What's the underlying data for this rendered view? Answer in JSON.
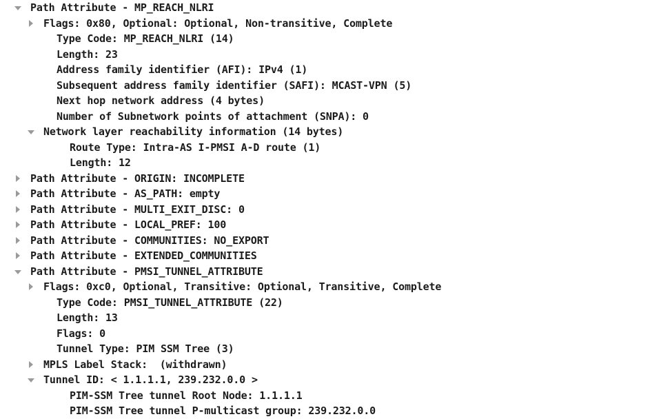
{
  "view": {
    "name": "packet-detail-tree",
    "app": "Wireshark packet details pane",
    "background_color": "#ffffff",
    "text_color": "#1b1b1b",
    "twisty_color": "#9a9a9a"
  },
  "tree": {
    "rows": [
      {
        "indent": 0,
        "twisty": "open",
        "twisty_icon": "triangle-down-icon",
        "name": "path-attribute-mp-reach-nlri",
        "label": "Path Attribute - MP_REACH_NLRI"
      },
      {
        "indent": 1,
        "twisty": "closed",
        "twisty_icon": "triangle-right-icon",
        "name": "mp-reach-flags",
        "label": "Flags: 0x80, Optional: Optional, Non-transitive, Complete"
      },
      {
        "indent": 2,
        "twisty": "none",
        "twisty_icon": "",
        "name": "mp-reach-type-code",
        "label": "Type Code: MP_REACH_NLRI (14)"
      },
      {
        "indent": 2,
        "twisty": "none",
        "twisty_icon": "",
        "name": "mp-reach-length",
        "label": "Length: 23"
      },
      {
        "indent": 2,
        "twisty": "none",
        "twisty_icon": "",
        "name": "address-family-identifier",
        "label": "Address family identifier (AFI): IPv4 (1)"
      },
      {
        "indent": 2,
        "twisty": "none",
        "twisty_icon": "",
        "name": "subsequent-address-family-identifier",
        "label": "Subsequent address family identifier (SAFI): MCAST-VPN (5)"
      },
      {
        "indent": 2,
        "twisty": "none",
        "twisty_icon": "",
        "name": "next-hop-network-address",
        "label": "Next hop network address (4 bytes)"
      },
      {
        "indent": 2,
        "twisty": "none",
        "twisty_icon": "",
        "name": "number-of-snpa",
        "label": "Number of Subnetwork points of attachment (SNPA): 0"
      },
      {
        "indent": 1,
        "twisty": "open",
        "twisty_icon": "triangle-down-icon",
        "name": "network-layer-reachability-information",
        "label": "Network layer reachability information (14 bytes)"
      },
      {
        "indent": 3,
        "twisty": "none",
        "twisty_icon": "",
        "name": "route-type",
        "label": "Route Type: Intra-AS I-PMSI A-D route (1)"
      },
      {
        "indent": 3,
        "twisty": "none",
        "twisty_icon": "",
        "name": "nlri-length",
        "label": "Length: 12"
      },
      {
        "indent": 0,
        "twisty": "closed",
        "twisty_icon": "triangle-right-icon",
        "name": "path-attribute-origin",
        "label": "Path Attribute - ORIGIN: INCOMPLETE"
      },
      {
        "indent": 0,
        "twisty": "closed",
        "twisty_icon": "triangle-right-icon",
        "name": "path-attribute-as-path",
        "label": "Path Attribute - AS_PATH: empty"
      },
      {
        "indent": 0,
        "twisty": "closed",
        "twisty_icon": "triangle-right-icon",
        "name": "path-attribute-multi-exit-disc",
        "label": "Path Attribute - MULTI_EXIT_DISC: 0"
      },
      {
        "indent": 0,
        "twisty": "closed",
        "twisty_icon": "triangle-right-icon",
        "name": "path-attribute-local-pref",
        "label": "Path Attribute - LOCAL_PREF: 100"
      },
      {
        "indent": 0,
        "twisty": "closed",
        "twisty_icon": "triangle-right-icon",
        "name": "path-attribute-communities",
        "label": "Path Attribute - COMMUNITIES: NO_EXPORT"
      },
      {
        "indent": 0,
        "twisty": "closed",
        "twisty_icon": "triangle-right-icon",
        "name": "path-attribute-extended-communities",
        "label": "Path Attribute - EXTENDED_COMMUNITIES"
      },
      {
        "indent": 0,
        "twisty": "open",
        "twisty_icon": "triangle-down-icon",
        "name": "path-attribute-pmsi-tunnel-attribute",
        "label": "Path Attribute - PMSI_TUNNEL_ATTRIBUTE"
      },
      {
        "indent": 1,
        "twisty": "closed",
        "twisty_icon": "triangle-right-icon",
        "name": "pmsi-flags",
        "label": "Flags: 0xc0, Optional, Transitive: Optional, Transitive, Complete"
      },
      {
        "indent": 2,
        "twisty": "none",
        "twisty_icon": "",
        "name": "pmsi-type-code",
        "label": "Type Code: PMSI_TUNNEL_ATTRIBUTE (22)"
      },
      {
        "indent": 2,
        "twisty": "none",
        "twisty_icon": "",
        "name": "pmsi-length",
        "label": "Length: 13"
      },
      {
        "indent": 2,
        "twisty": "none",
        "twisty_icon": "",
        "name": "pmsi-inner-flags",
        "label": "Flags: 0"
      },
      {
        "indent": 2,
        "twisty": "none",
        "twisty_icon": "",
        "name": "tunnel-type",
        "label": "Tunnel Type: PIM SSM Tree (3)"
      },
      {
        "indent": 1,
        "twisty": "closed",
        "twisty_icon": "triangle-right-icon",
        "name": "mpls-label-stack",
        "label": "MPLS Label Stack:  (withdrawn)"
      },
      {
        "indent": 1,
        "twisty": "open",
        "twisty_icon": "triangle-down-icon",
        "name": "tunnel-id",
        "label": "Tunnel ID: < 1.1.1.1, 239.232.0.0 >"
      },
      {
        "indent": 3,
        "twisty": "none",
        "twisty_icon": "",
        "name": "pim-ssm-root-node",
        "label": "PIM-SSM Tree tunnel Root Node: 1.1.1.1"
      },
      {
        "indent": 3,
        "twisty": "none",
        "twisty_icon": "",
        "name": "pim-ssm-p-multicast-group",
        "label": "PIM-SSM Tree tunnel P-multicast group: 239.232.0.0"
      }
    ]
  }
}
